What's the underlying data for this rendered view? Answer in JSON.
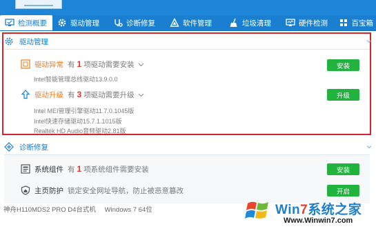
{
  "tabs": [
    {
      "label": "检测概要",
      "icon": "monitor-check-icon",
      "active": true
    },
    {
      "label": "驱动管理",
      "icon": "gear-icon",
      "active": false
    },
    {
      "label": "诊断修复",
      "icon": "stethoscope-icon",
      "active": false
    },
    {
      "label": "软件管理",
      "icon": "software-triangle-icon",
      "active": false
    },
    {
      "label": "垃圾清理",
      "icon": "broom-icon",
      "active": false
    },
    {
      "label": "硬件检测",
      "icon": "hardware-monitor-icon",
      "active": false
    },
    {
      "label": "百宝箱",
      "icon": "toolbox-icon",
      "active": false
    }
  ],
  "driver_section": {
    "title": "驱动管理",
    "abnormal": {
      "title": "驱动异常",
      "prefix": "有",
      "count": "1",
      "suffix": "项驱动需要安装",
      "button": "安装",
      "details": [
        "Intel智能管理总线驱动13.9.0.0"
      ]
    },
    "upgrade": {
      "title": "驱动升级",
      "prefix": "有",
      "count": "3",
      "suffix": "项驱动需要升级",
      "button": "升级",
      "details": [
        "Intel MEI管理引擎驱动11.7.0.1045版",
        "Intel快速存储驱动15.7.1.1015版",
        "Realtek HD Audio音频驱动2.81版"
      ]
    }
  },
  "diag_section": {
    "title": "诊断修复",
    "components": {
      "title": "系统组件",
      "prefix": "有",
      "count": "1",
      "suffix": "项系统组件需要安装",
      "button": "安装"
    },
    "homepage": {
      "title": "主页防护",
      "desc": "锁定安全网址导航，防止被恶意篡改",
      "button": "开启"
    }
  },
  "footer": {
    "machine": "神舟H110MDS2 PRO D4台式机",
    "os": "Windows 7 64位"
  },
  "watermark": {
    "brand_a": "Win",
    "brand_b": "7",
    "brand_c": "系统之家",
    "url": "Www.Winwin7.com"
  },
  "colors": {
    "tab_bar": "#1a7fd1",
    "accent": "#1a7fd1",
    "warning": "#f07a1c",
    "count": "#e9322b",
    "button": "#21b33d",
    "highlight_box": "#d9232c"
  }
}
